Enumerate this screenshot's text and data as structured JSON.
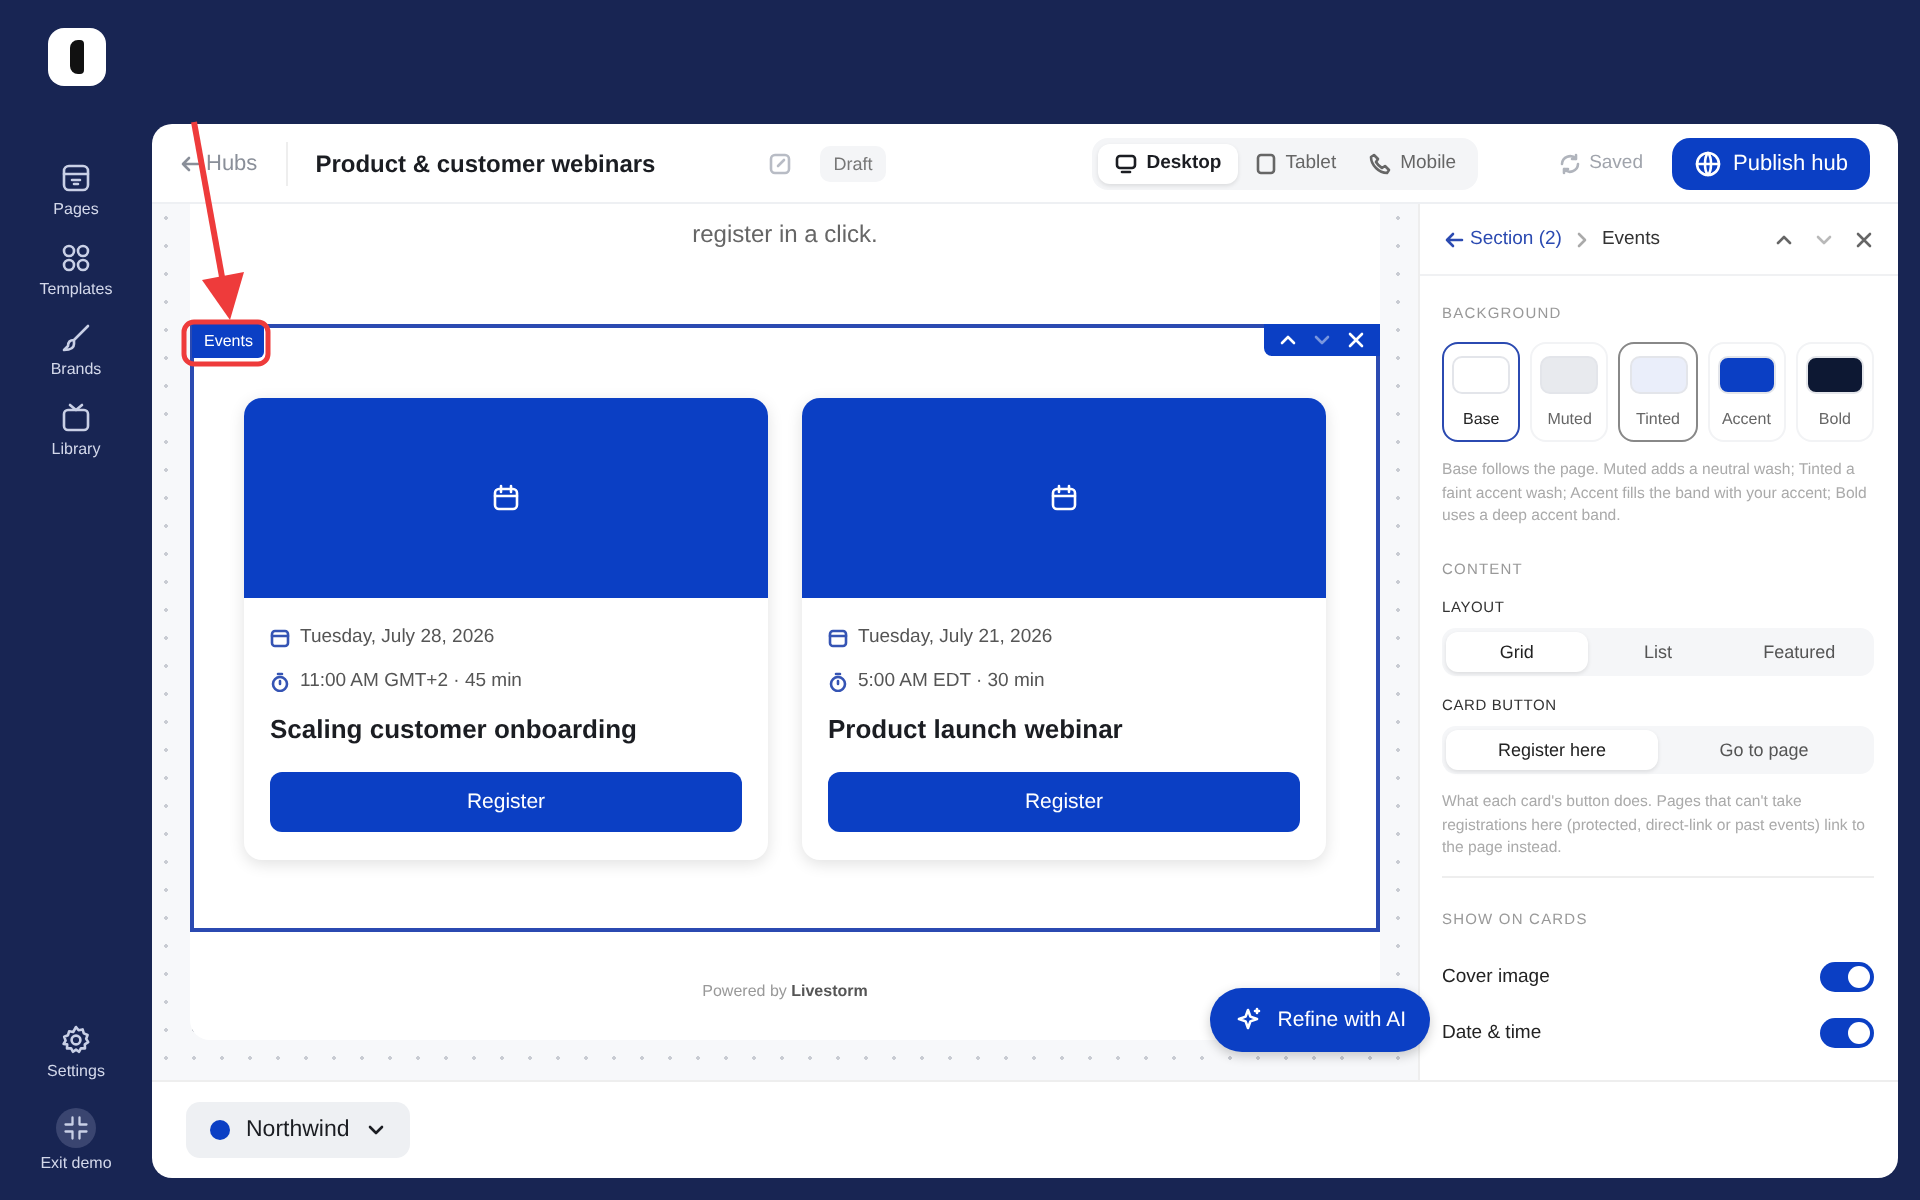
{
  "sidebar": {
    "items": [
      {
        "label": "Pages"
      },
      {
        "label": "Templates"
      },
      {
        "label": "Brands"
      },
      {
        "label": "Library"
      }
    ],
    "bottom_items": [
      {
        "label": "Settings"
      },
      {
        "label": "Exit demo"
      }
    ]
  },
  "header": {
    "back": "Hubs",
    "title": "Product & customer webinars",
    "status": "Draft",
    "devices": [
      {
        "label": "Desktop",
        "selected": true
      },
      {
        "label": "Tablet",
        "selected": false
      },
      {
        "label": "Mobile",
        "selected": false
      }
    ],
    "saved": "Saved",
    "publish": "Publish hub"
  },
  "canvas": {
    "subtitle": "register in a click.",
    "section_tag": "Events",
    "events": [
      {
        "date": "Tuesday, July 28, 2026",
        "time": "11:00 AM GMT+2 · 45 min",
        "title": "Scaling customer onboarding",
        "button": "Register"
      },
      {
        "date": "Tuesday, July 21, 2026",
        "time": "5:00 AM EDT · 30 min",
        "title": "Product launch webinar",
        "button": "Register"
      }
    ],
    "powered": "Powered by **Livestorm**",
    "refine": "Refine with AI"
  },
  "panel": {
    "back": "Section (2)",
    "current": "Events",
    "background": {
      "heading": "BACKGROUND",
      "swatches": [
        {
          "label": "Base",
          "color": "#ffffff",
          "selected": true,
          "hover": false
        },
        {
          "label": "Muted",
          "color": "#e8eaee",
          "selected": false,
          "hover": false
        },
        {
          "label": "Tinted",
          "color": "#eaeefa",
          "selected": false,
          "hover": true
        },
        {
          "label": "Accent",
          "color": "#0b3fc4",
          "selected": false,
          "hover": false
        },
        {
          "label": "Bold",
          "color": "#0d1833",
          "selected": false,
          "hover": false
        }
      ],
      "help": "Base follows the page. Muted adds a neutral wash; Tinted a faint accent wash; Accent fills the band with your accent; Bold uses a deep accent band."
    },
    "content_heading": "CONTENT",
    "layout": {
      "heading": "LAYOUT",
      "options": [
        {
          "label": "Grid",
          "selected": true
        },
        {
          "label": "List",
          "selected": false
        },
        {
          "label": "Featured",
          "selected": false
        }
      ]
    },
    "card_button": {
      "heading": "CARD BUTTON",
      "options": [
        {
          "label": "Register here",
          "selected": true
        },
        {
          "label": "Go to page",
          "selected": false
        }
      ],
      "help": "What each card's button does. Pages that can't take registrations here (protected, direct-link or past events) link to the page instead."
    },
    "show_on_cards": {
      "heading": "SHOW ON CARDS",
      "toggles": [
        {
          "label": "Cover image",
          "on": true
        },
        {
          "label": "Date & time",
          "on": true
        }
      ]
    }
  },
  "brand": {
    "name": "Northwind"
  }
}
